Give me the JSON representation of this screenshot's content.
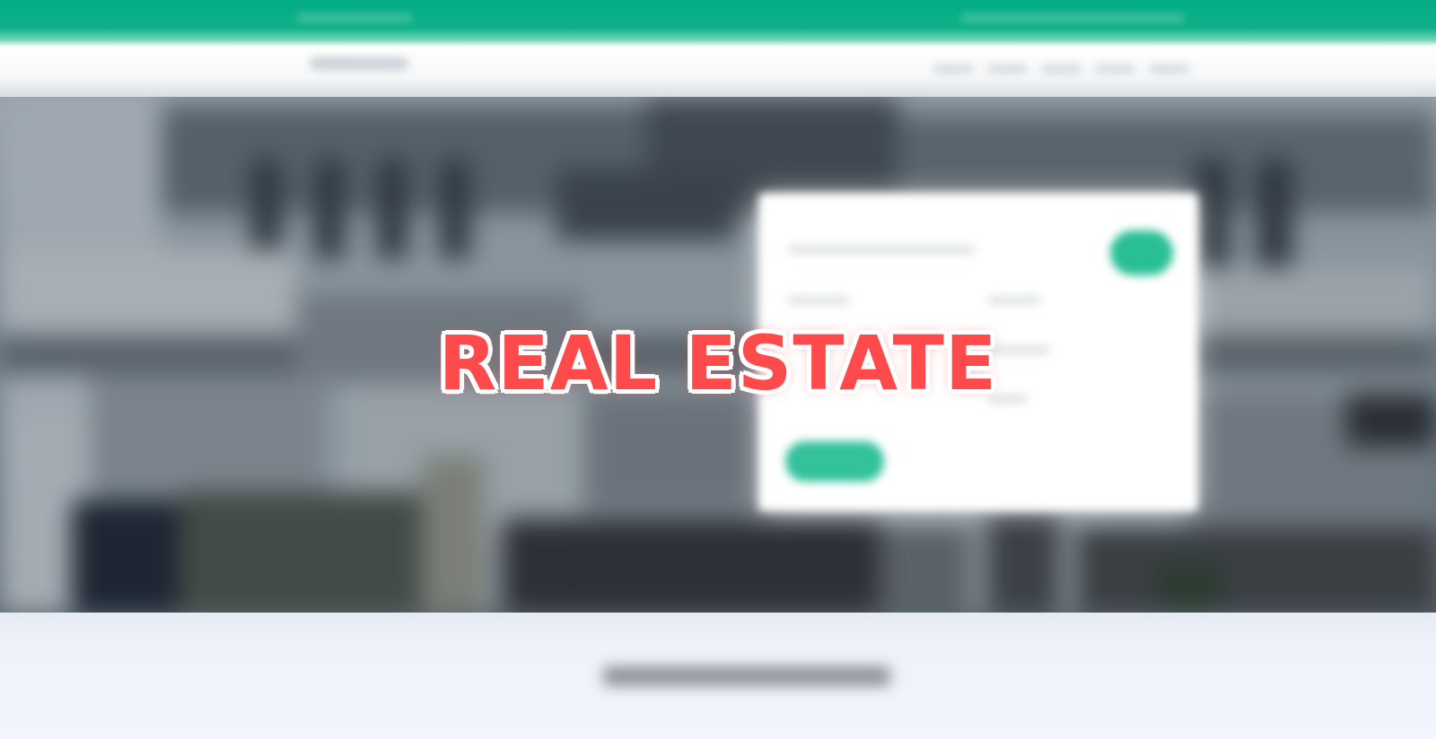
{
  "page": {
    "overlay_title": "REAL ESTATE"
  },
  "colors": {
    "brand_green": "#04ad84",
    "accent_button": "#33c29c",
    "title_red": "#ff4a4c",
    "bottom_background": "#f2f5fd"
  },
  "icons": {
    "card_action": "circle-button-icon"
  }
}
